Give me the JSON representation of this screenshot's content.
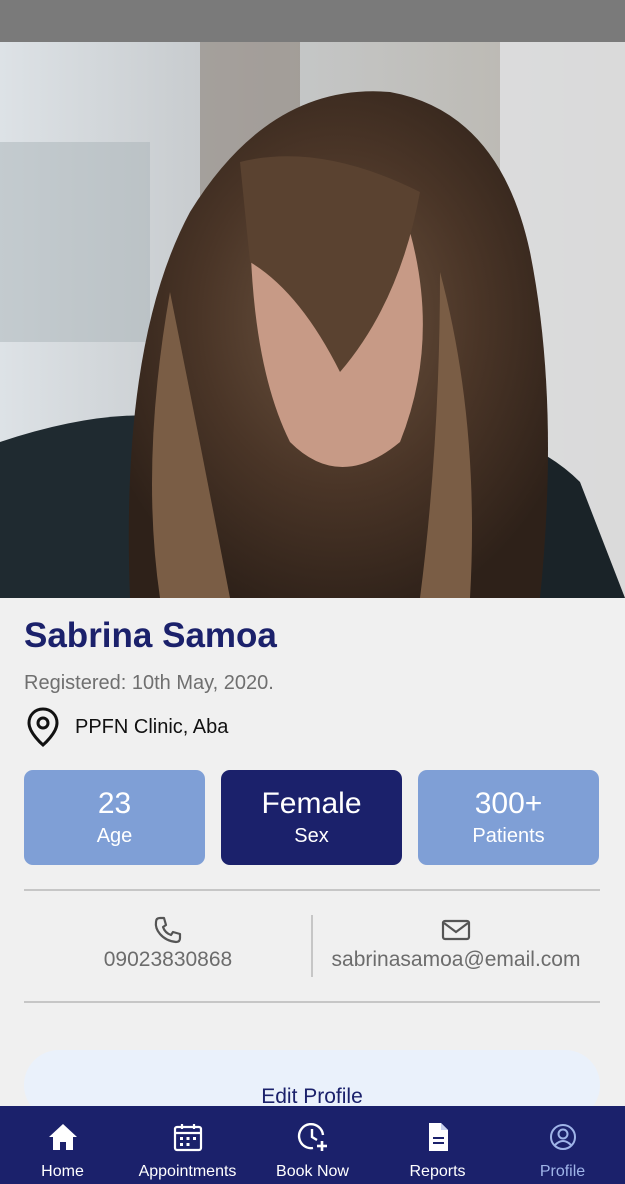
{
  "profile": {
    "name": "Sabrina Samoa",
    "registered": "Registered: 10th May, 2020.",
    "location": "PPFN Clinic, Aba",
    "photo_icon": "profile-photo"
  },
  "stats": [
    {
      "value": "23",
      "label": "Age",
      "style": "light"
    },
    {
      "value": "Female",
      "label": "Sex",
      "style": "dark"
    },
    {
      "value": "300+",
      "label": "Patients",
      "style": "light"
    }
  ],
  "contact": {
    "phone": "09023830868",
    "email": "sabrinasamoa@email.com"
  },
  "actions": {
    "edit_profile": "Edit Profile"
  },
  "nav": [
    {
      "label": "Home",
      "icon": "home-icon"
    },
    {
      "label": "Appointments",
      "icon": "calendar-icon"
    },
    {
      "label": "Book Now",
      "icon": "clock-plus-icon"
    },
    {
      "label": "Reports",
      "icon": "document-icon"
    },
    {
      "label": "Profile",
      "icon": "user-circle-icon",
      "active": true
    }
  ],
  "colors": {
    "primary": "#1b216b",
    "accent_light": "#7f9fd6",
    "nav_active": "#9fb4e8",
    "button_bg": "#eaf1fb",
    "background": "#f0f0f0"
  }
}
